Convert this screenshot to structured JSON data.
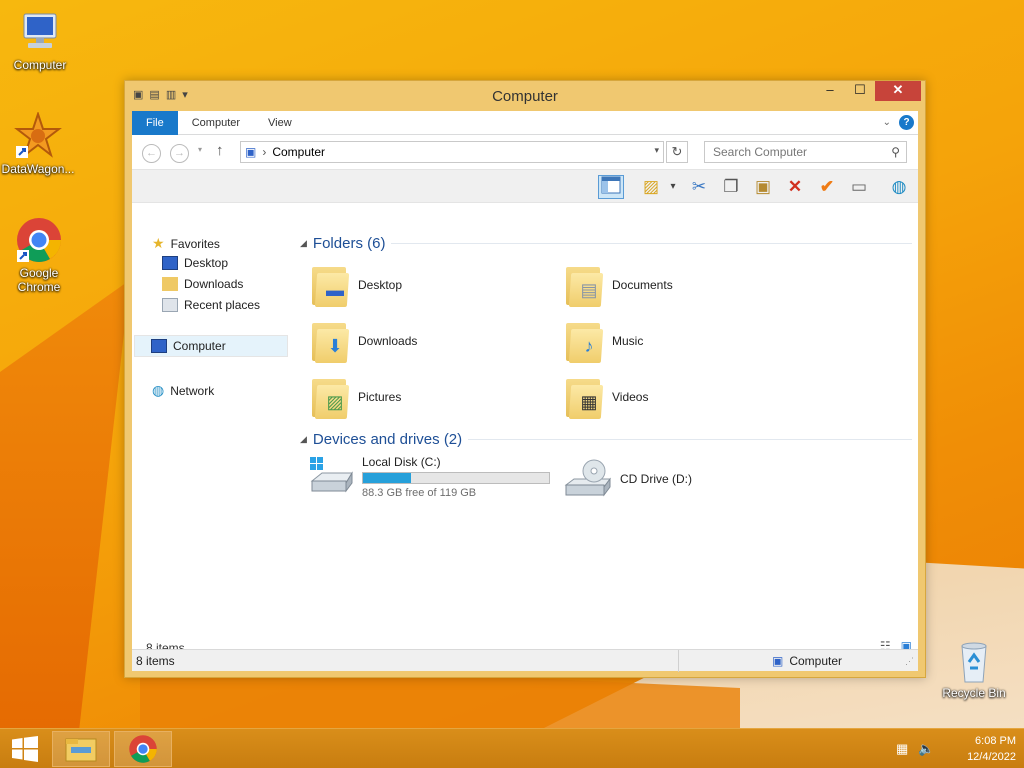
{
  "desktop": {
    "icons": [
      {
        "label": "Computer"
      },
      {
        "label": "DataWagon..."
      },
      {
        "label": "Google Chrome"
      },
      {
        "label": "Recycle Bin"
      }
    ]
  },
  "window": {
    "title": "Computer",
    "controls": {
      "minimize": "‒",
      "maximize": "☐",
      "close": "✕"
    },
    "tabs": [
      "File",
      "Computer",
      "View"
    ],
    "address": {
      "location": "Computer",
      "separator": "›"
    },
    "search": {
      "placeholder": "Search Computer"
    },
    "nav": {
      "favorites": "Favorites",
      "favorite_items": [
        "Desktop",
        "Downloads",
        "Recent places"
      ],
      "computer": "Computer",
      "network": "Network"
    },
    "folders_group": "Folders (6)",
    "folders": [
      "Desktop",
      "Documents",
      "Downloads",
      "Music",
      "Pictures",
      "Videos"
    ],
    "devices_group": "Devices and drives (2)",
    "drives": [
      {
        "name": "Local Disk (C:)",
        "free": "88.3 GB free of 119 GB",
        "used_fraction": 0.26
      },
      {
        "name": "CD Drive (D:)"
      }
    ],
    "item_count": "8 items",
    "status": {
      "left": "8 items",
      "right": "Computer"
    }
  },
  "taskbar": {
    "time": "6:08 PM",
    "date": "12/4/2022"
  },
  "colors": {
    "accent": "#1979ca",
    "close": "#c7443a",
    "group_header": "#1e4f96",
    "disk_bar": "#26a0da"
  }
}
